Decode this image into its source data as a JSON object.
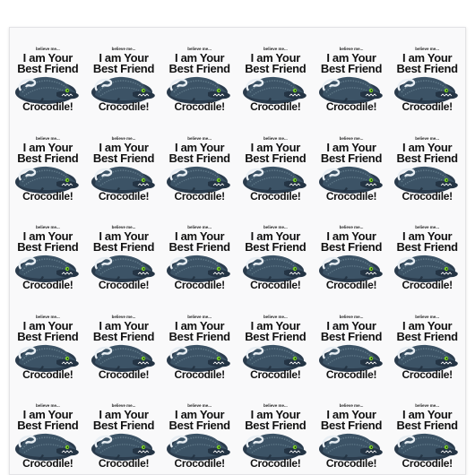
{
  "sheet": {
    "rows": 5,
    "columns": 6,
    "sticker": {
      "small_text": "believe me...",
      "line1": "I am Your",
      "line2": "Best Friend",
      "bottom": "Crocodile!",
      "art_icon": "crocodile-illustration"
    }
  },
  "colors": {
    "croc_body": "#3c5366",
    "croc_dark": "#243444",
    "croc_belly": "#5f7888",
    "eye": "#7bd12a",
    "sheet": "#f9f9fa"
  }
}
